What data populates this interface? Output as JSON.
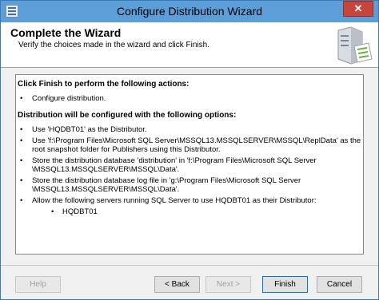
{
  "window": {
    "title": "Configure Distribution Wizard",
    "close_glyph": "✕"
  },
  "header": {
    "title": "Complete the Wizard",
    "subtitle": "Verify the choices made in the wizard and click Finish."
  },
  "summary": {
    "heading1": "Click Finish to perform the following actions:",
    "actions": [
      "Configure distribution."
    ],
    "heading2": "Distribution will be configured with the following options:",
    "options": [
      "Use 'HQDBT01' as the Distributor.",
      "Use 'f:\\Program Files\\Microsoft SQL Server\\MSSQL13.MSSQLSERVER\\MSSQL\\ReplData' as the root snapshot folder for Publishers using this Distributor.",
      "Store the distribution database 'distribution' in 'f:\\Program Files\\Microsoft SQL Server \\MSSQL13.MSSQLSERVER\\MSSQL\\Data'.",
      "Store the distribution database log file in 'g:\\Program Files\\Microsoft SQL Server \\MSSQL13.MSSQLSERVER\\MSSQL\\Data'.",
      "Allow the following servers running SQL Server to use HQDBT01 as their Distributor:"
    ],
    "servers": [
      "HQDBT01"
    ]
  },
  "buttons": {
    "help": "Help",
    "back": "< Back",
    "next": "Next >",
    "finish": "Finish",
    "cancel": "Cancel"
  }
}
